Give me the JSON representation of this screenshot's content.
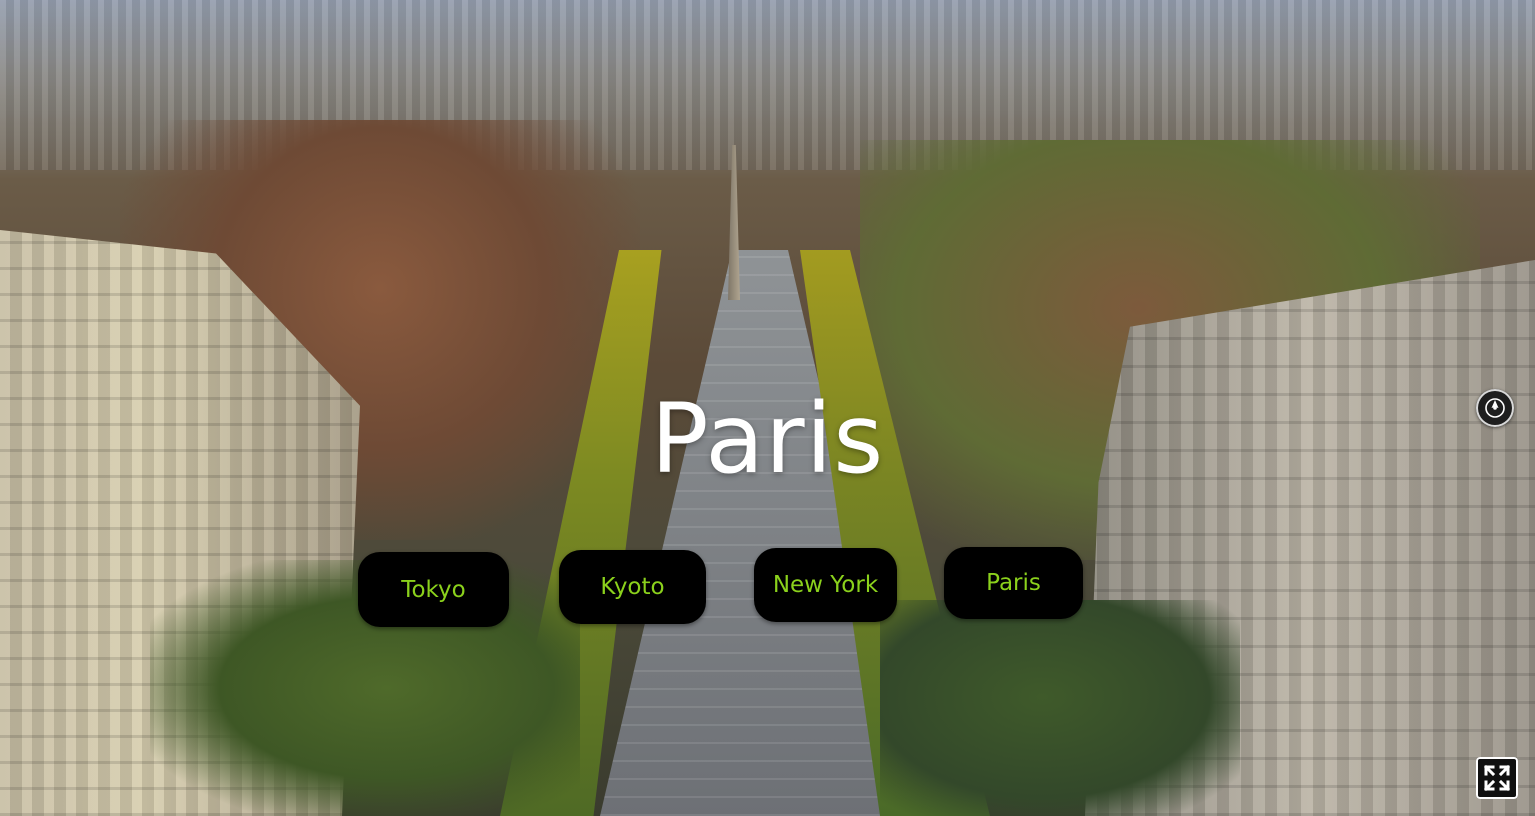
{
  "scene": {
    "title": "Paris",
    "background_icon": "aerial-city-photo"
  },
  "city_buttons": [
    {
      "label": "Tokyo"
    },
    {
      "label": "Kyoto"
    },
    {
      "label": "New York"
    },
    {
      "label": "Paris"
    }
  ],
  "controls": {
    "compass_icon": "compass-icon",
    "fullscreen_icon": "fullscreen-icon"
  },
  "colors": {
    "title_text": "#ffffff",
    "button_background": "#000000",
    "button_text": "#8bd11c"
  }
}
